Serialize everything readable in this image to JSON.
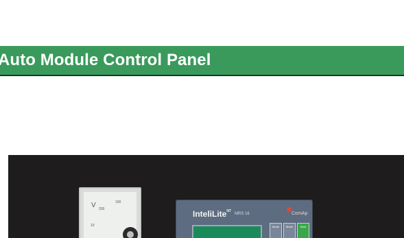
{
  "title_bar": {
    "text": "Auto Module Control Panel",
    "background": "#3a9a5c",
    "text_color": "#ffffff"
  },
  "photo": {
    "voltmeter": {
      "unit": "V",
      "ticks": [
        "200",
        "100",
        "10"
      ]
    },
    "controller": {
      "brand": "InteliLite",
      "brand_superscript": "NT",
      "model": "MRS 16",
      "maker": "ComAp",
      "buttons": [
        "Mode",
        "Mode",
        "Start"
      ],
      "lcd_color": "#1b8a5a"
    }
  }
}
